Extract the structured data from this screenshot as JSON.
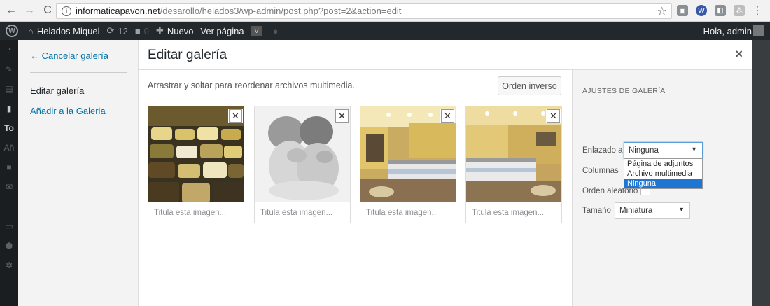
{
  "browser": {
    "url_host": "informaticapavon.net",
    "url_path": "/desarollo/helados3/wp-admin/post.php?post=2&action=edit"
  },
  "adminbar": {
    "site_name": "Helados Miquel",
    "updates_count": "12",
    "comments_count": "0",
    "new_label": "Nuevo",
    "view_page_label": "Ver página",
    "greeting": "Hola, admin"
  },
  "sidebar": {
    "cancel_label": "← Cancelar galería",
    "active_label": "Editar galería",
    "add_label": "Añadir a la Galeria"
  },
  "header": {
    "title": "Editar galería",
    "close_glyph": "×"
  },
  "content": {
    "instructions": "Arrastrar y soltar para reordenar archivos multimedia.",
    "reverse_button": "Orden inverso",
    "thumbnails": [
      {
        "caption_placeholder": "Titula esta imagen..."
      },
      {
        "caption_placeholder": "Titula esta imagen..."
      },
      {
        "caption_placeholder": "Titula esta imagen..."
      },
      {
        "caption_placeholder": "Titula esta imagen..."
      }
    ]
  },
  "settings": {
    "heading": "AJUSTES DE GALERÍA",
    "link_to_label": "Enlazado a",
    "link_to_value": "Ninguna",
    "link_to_options": [
      "Página de adjuntos",
      "Archivo multimedia",
      "Ninguna"
    ],
    "columns_label": "Columnas",
    "random_label": "Orden aleatorio",
    "size_label": "Tamaño",
    "size_value": "Miniatura"
  },
  "colors": {
    "link": "#0073aa",
    "adminbar": "#23282d",
    "selected_option": "#1e76d2"
  }
}
